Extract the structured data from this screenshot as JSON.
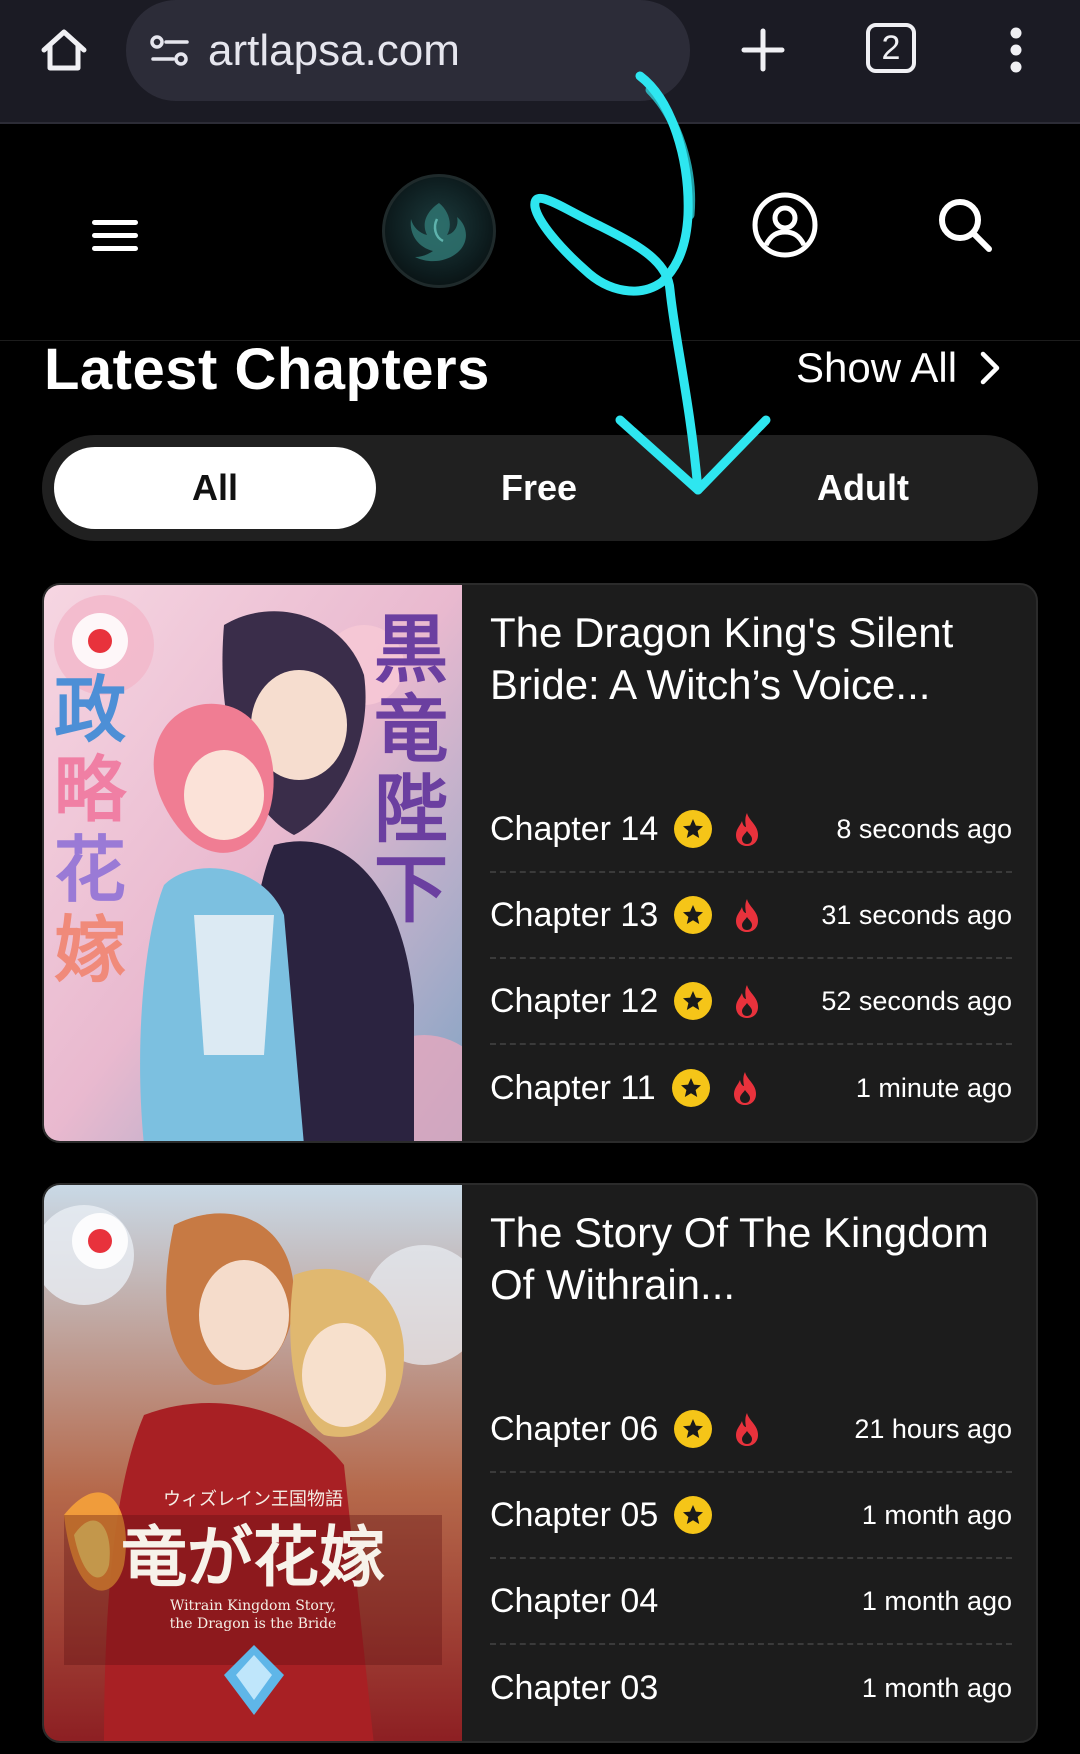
{
  "browser": {
    "url": "artlapsa.com",
    "tab_count": "2"
  },
  "colors": {
    "background": "#000000",
    "card": "#1c1c1c",
    "star": "#f5c518",
    "fire": "#e8323c",
    "annotation": "#2ee6f0"
  },
  "section": {
    "title": "Latest Chapters",
    "show_all": "Show All"
  },
  "filters": [
    {
      "label": "All",
      "active": true
    },
    {
      "label": "Free",
      "active": false
    },
    {
      "label": "Adult",
      "active": false
    }
  ],
  "series": [
    {
      "title": "The Dragon King's Silent Bride: A Witch’s Voice...",
      "chapters": [
        {
          "label": "Chapter 14",
          "time": "8 seconds ago",
          "icons": [
            "star-icon",
            "fire-icon"
          ]
        },
        {
          "label": "Chapter 13",
          "time": "31 seconds ago",
          "icons": [
            "star-icon",
            "fire-icon"
          ]
        },
        {
          "label": "Chapter 12",
          "time": "52 seconds ago",
          "icons": [
            "star-icon",
            "fire-icon"
          ]
        },
        {
          "label": "Chapter 11",
          "time": "1 minute ago",
          "icons": [
            "star-icon",
            "fire-icon"
          ]
        }
      ]
    },
    {
      "title": "The Story Of The Kingdom Of Withrain...",
      "chapters": [
        {
          "label": "Chapter 06",
          "time": "21 hours ago",
          "icons": [
            "star-icon",
            "fire-icon"
          ]
        },
        {
          "label": "Chapter 05",
          "time": "1 month ago",
          "icons": [
            "star-icon"
          ]
        },
        {
          "label": "Chapter 04",
          "time": "1 month ago",
          "icons": []
        },
        {
          "label": "Chapter 03",
          "time": "1 month ago",
          "icons": []
        }
      ]
    }
  ]
}
